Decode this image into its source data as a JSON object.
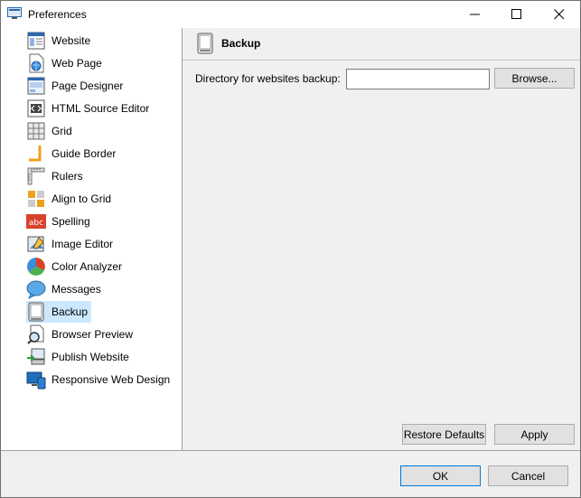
{
  "window": {
    "title": "Preferences",
    "app_icon": "preferences-window-icon"
  },
  "titlebar_buttons": {
    "minimize": "minimize-icon",
    "maximize": "maximize-icon",
    "close": "close-icon"
  },
  "sidebar": {
    "selected": "Backup",
    "items": [
      {
        "label": "Website",
        "icon": "website-icon"
      },
      {
        "label": "Web Page",
        "icon": "web-page-icon"
      },
      {
        "label": "Page Designer",
        "icon": "page-designer-icon"
      },
      {
        "label": "HTML Source Editor",
        "icon": "html-source-editor-icon"
      },
      {
        "label": "Grid",
        "icon": "grid-icon"
      },
      {
        "label": "Guide Border",
        "icon": "guide-border-icon"
      },
      {
        "label": "Rulers",
        "icon": "rulers-icon"
      },
      {
        "label": "Align to Grid",
        "icon": "align-to-grid-icon"
      },
      {
        "label": "Spelling",
        "icon": "spelling-icon"
      },
      {
        "label": "Image Editor",
        "icon": "image-editor-icon"
      },
      {
        "label": "Color Analyzer",
        "icon": "color-analyzer-icon"
      },
      {
        "label": "Messages",
        "icon": "messages-icon"
      },
      {
        "label": "Backup",
        "icon": "backup-icon"
      },
      {
        "label": "Browser Preview",
        "icon": "browser-preview-icon"
      },
      {
        "label": "Publish Website",
        "icon": "publish-website-icon"
      },
      {
        "label": "Responsive Web Design",
        "icon": "responsive-web-design-icon"
      }
    ]
  },
  "panel": {
    "title": "Backup",
    "icon": "backup-icon",
    "directory_label": "Directory for websites backup:",
    "directory_value": "",
    "browse_label": "Browse...",
    "restore_defaults_label": "Restore Defaults",
    "apply_label": "Apply"
  },
  "footer": {
    "ok_label": "OK",
    "cancel_label": "Cancel"
  },
  "colors": {
    "selection": "#cce8ff",
    "accent_border": "#0078d7",
    "spelling_red": "#d9412b",
    "grid_blue": "#1f6fbf"
  }
}
